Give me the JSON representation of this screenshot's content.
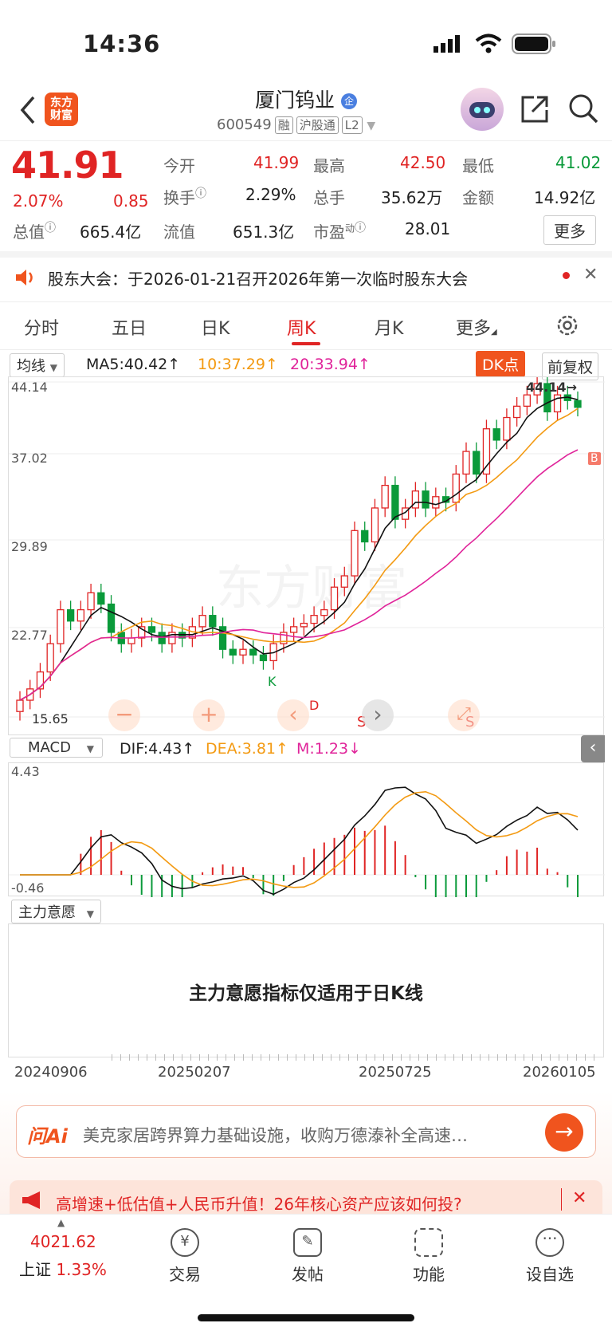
{
  "status": {
    "time": "14:36"
  },
  "header": {
    "logo_line1": "东方",
    "logo_line2": "财富",
    "name": "厦门钨业",
    "code": "600549",
    "tags": [
      "融",
      "沪股通",
      "L2"
    ]
  },
  "quote": {
    "price": "41.91",
    "change_pct": "2.07%",
    "change_abs": "0.85",
    "open_label": "今开",
    "open": "41.99",
    "high_label": "最高",
    "high": "42.50",
    "low_label": "最低",
    "low": "41.02",
    "turnover_label": "换手",
    "turnover": "2.29%",
    "volume_label": "总手",
    "volume": "35.62万",
    "amount_label": "金额",
    "amount": "14.92亿",
    "mktcap_label": "总值",
    "mktcap": "665.4亿",
    "float_label": "流值",
    "float": "651.3亿",
    "pe_label": "市盈",
    "pe_sup": "动",
    "pe": "28.01",
    "more": "更多"
  },
  "notice": {
    "text": "股东大会：于2026-01-21召开2026年第一次临时股东大会"
  },
  "tabs": [
    "分时",
    "五日",
    "日K",
    "周K",
    "月K",
    "更多"
  ],
  "active_tab": "周K",
  "ma_bar": {
    "selector": "均线",
    "ma5": "MA5:40.42↑",
    "ma10": "10:37.29↑",
    "ma20": "20:33.94↑",
    "dk": "DK点",
    "fq": "前复权"
  },
  "kline": {
    "y_ticks": [
      "44.14",
      "37.02",
      "29.89",
      "22.77",
      "15.65"
    ],
    "max_label": "44.14→",
    "min_label": "15.65",
    "markers": {
      "k": "K",
      "d": "D",
      "b": "B",
      "s": "S"
    },
    "watermark": "东方财富"
  },
  "macd_bar": {
    "selector": "MACD",
    "dif": "DIF:4.43↑",
    "dea": "DEA:3.81↑",
    "m": "M:1.23↓",
    "top": "4.43",
    "bottom": "-0.46"
  },
  "zlyy": {
    "selector": "主力意愿",
    "message": "主力意愿指标仅适用于日K线"
  },
  "dates": [
    "20240906",
    "20250207",
    "20250725",
    "20260105"
  ],
  "ai": {
    "logo": "问Ai",
    "text": "美克家居跨界算力基础设施，收购万德溙补全高速…"
  },
  "banner": {
    "text": "高增速+低估值+人民币升值！26年核心资产应该如何投?"
  },
  "nav": {
    "index_value": "4021.62",
    "index_name": "上证",
    "index_pct": "1.33%",
    "items": [
      "交易",
      "发帖",
      "功能",
      "设自选"
    ]
  },
  "colors": {
    "up": "#e02424",
    "down": "#0a9a3a",
    "ma10": "#f39a12",
    "ma20": "#e0249a",
    "accent": "#f0541e"
  }
}
